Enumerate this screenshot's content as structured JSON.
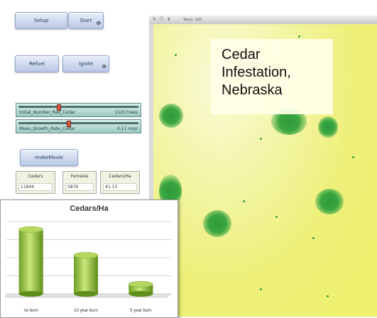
{
  "controls": {
    "setup_label": "Setup",
    "start_label": "Start",
    "refuel_label": "Refuel",
    "ignite_label": "Ignite",
    "forever_glyph": "⟳",
    "makemovie_label": "makeMovie"
  },
  "sliders": [
    {
      "label": "Initial_Number_Red_Cedar",
      "value": "1120 trees",
      "fraction": 0.33
    },
    {
      "label": "Mean_Growth_Rate_Cedar",
      "value": "0.17 m/yr",
      "fraction": 0.42
    }
  ],
  "monitors": [
    {
      "label": "Cedars",
      "value": "11844"
    },
    {
      "label": "Females",
      "value": "5876"
    },
    {
      "label": "Cedars/Ha",
      "value": "41.13"
    }
  ],
  "world": {
    "toolbar_text": "Years: 100",
    "icons": [
      "brush-icon",
      "info-icon",
      "arrows-icon"
    ]
  },
  "caption": {
    "line1": "Cedar",
    "line2": "Infestation,",
    "line3": "Nebraska"
  },
  "chart_data": {
    "type": "bar",
    "title": "Cedars/Ha",
    "categories": [
      "no burn",
      "10 year burn",
      "5 year burn"
    ],
    "values": [
      40,
      24,
      6
    ],
    "ylim": [
      0,
      45
    ],
    "grid": true,
    "xlabel": "",
    "ylabel": "",
    "bar_color": "#8fc23a"
  }
}
